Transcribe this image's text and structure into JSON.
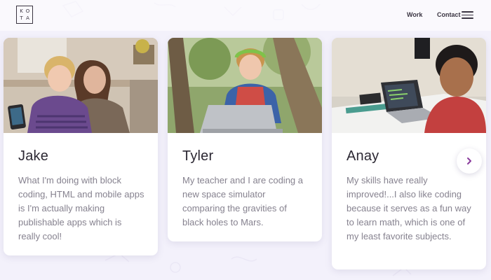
{
  "header": {
    "logo_letters": [
      "K",
      "O",
      "T",
      "A"
    ],
    "nav": {
      "work_label": "Work",
      "contact_label": "Contact"
    },
    "menu_icon": "hamburger-icon"
  },
  "testimonials": [
    {
      "name": "Jake",
      "quote": "What I'm doing with block coding, HTML and mobile apps is I'm actually making publishable apps which is really cool!",
      "photo": "boy-and-mother-on-couch-with-phone"
    },
    {
      "name": "Tyler",
      "quote": "My teacher and I are coding a new space simulator comparing the gravities of black holes to Mars.",
      "photo": "boy-with-headphones-laptop-outdoors"
    },
    {
      "name": "Anay",
      "quote": "My skills have really improved!...I also like coding because it serves as a fun way to learn math, which is one of my least favorite subjects.",
      "photo": "boy-smiling-at-desk-with-laptop"
    }
  ],
  "carousel": {
    "next_icon": "chevron-right-icon"
  },
  "colors": {
    "background": "#f3f1fb",
    "card": "#ffffff",
    "name_text": "#2c2833",
    "quote_text": "#86828f",
    "accent_purple": "#8a3b9c"
  }
}
